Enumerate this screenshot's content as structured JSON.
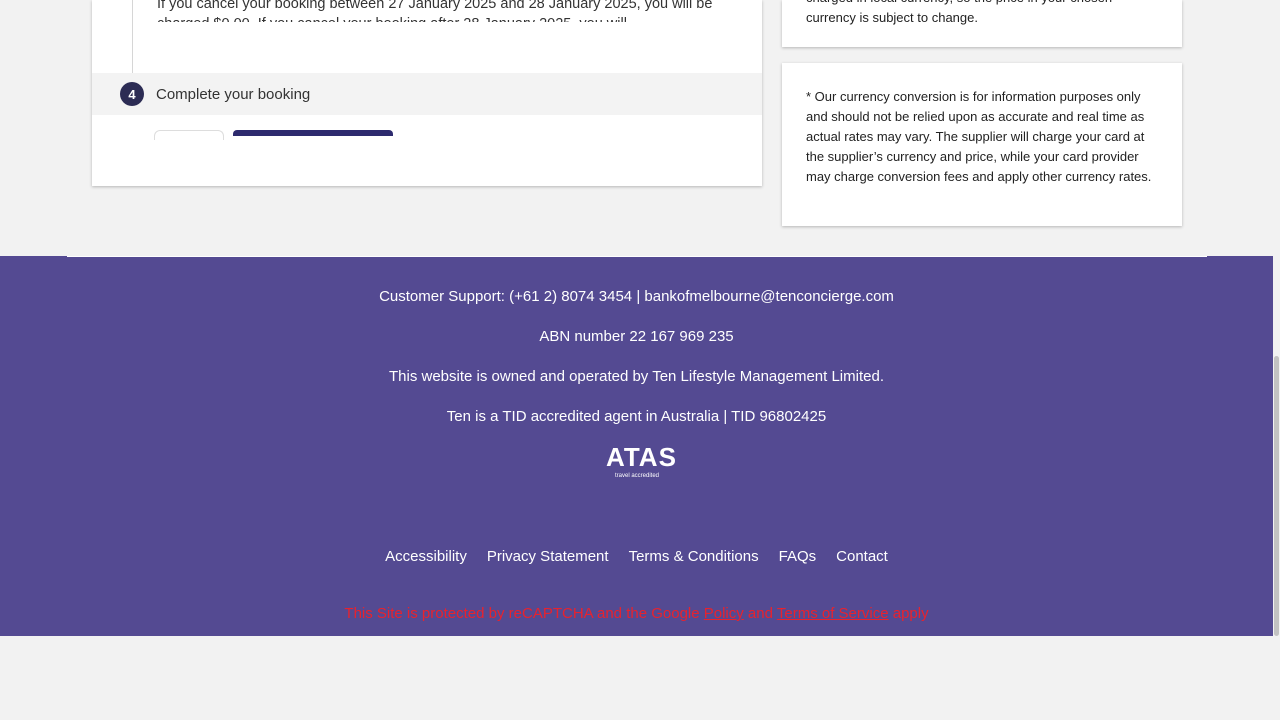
{
  "booking": {
    "cancellation_text": "If you cancel your booking between 27 January 2025 and 28 January 2025, you will be charged $0.00. If you cancel your booking after 28 January 2025, you will",
    "step_number": "4",
    "step_title": "Complete your booking"
  },
  "sidebar": {
    "currency_note": "charged in local currency, so the price in your chosen currency is subject to change.",
    "disclaimer": "* Our currency conversion is for information purposes only and should not be relied upon as accurate and real time as actual rates may vary. The supplier will charge your card at the supplier’s currency and price, while your card provider may charge conversion fees and apply other currency rates."
  },
  "footer": {
    "support": "Customer Support: (+61 2) 8074 3454 | bankofmelbourne@tenconcierge.com",
    "abn": "ABN number 22 167 969 235",
    "ownership": "This website is owned and operated by Ten Lifestyle Management Limited.",
    "tid": "Ten is a TID accredited agent in Australia | TID 96802425",
    "logo": {
      "mark": "ATAS",
      "subtitle": "travel accredited"
    },
    "links": [
      "Accessibility",
      "Privacy Statement",
      "Terms & Conditions",
      "FAQs",
      "Contact"
    ],
    "recaptcha": {
      "prefix": "This Site is protected by reCAPTCHA and the Google ",
      "policy": "Policy",
      "and": " and ",
      "terms": "Terms of Service",
      "suffix": " apply"
    }
  },
  "colors": {
    "footer_bg": "#544a92",
    "accent_dark": "#2d2a6e",
    "recaptcha_red": "#e8222e"
  }
}
